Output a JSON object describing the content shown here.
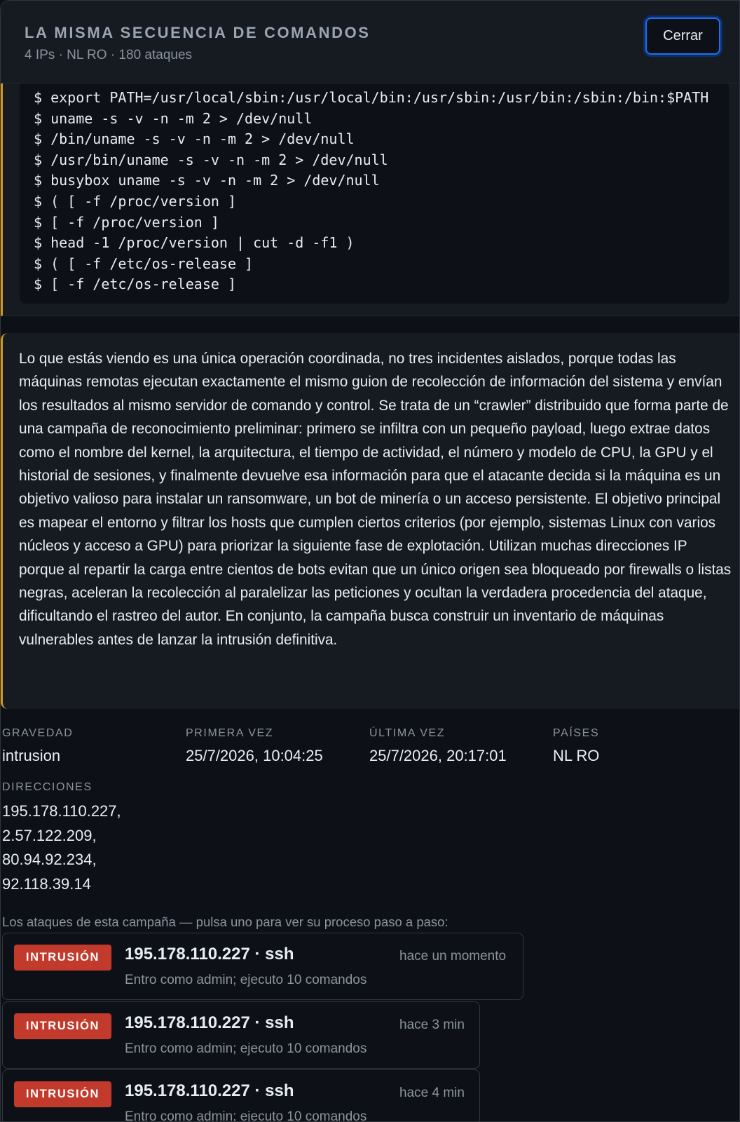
{
  "header": {
    "title": "LA MISMA SECUENCIA DE COMANDOS",
    "subtitle": "4 IPs · NL RO · 180 ataques",
    "close_label": "Cerrar"
  },
  "commands": [
    "$ export PATH=/usr/local/sbin:/usr/local/bin:/usr/sbin:/usr/bin:/sbin:/bin:$PATH",
    "$ uname -s -v -n -m 2 > /dev/null",
    "$ /bin/uname -s -v -n -m 2 > /dev/null",
    "$ /usr/bin/uname -s -v -n -m 2 > /dev/null",
    "$ busybox uname -s -v -n -m 2 > /dev/null",
    "$ ( [ -f /proc/version ]",
    "$ [ -f /proc/version ]",
    "$ head -1 /proc/version | cut -d -f1 )",
    "$ ( [ -f /etc/os-release ]",
    "$ [ -f /etc/os-release ]"
  ],
  "description": "Lo que estás viendo es una única operación coordinada, no tres incidentes aislados, porque todas las máquinas remotas ejecutan exactamente el mismo guion de recolección de información del sistema y envían los resultados al mismo servidor de comando y control. Se trata de un “crawler” distribuido que forma parte de una campaña de reconocimiento preliminar: primero se infiltra con un pequeño payload, luego extrae datos como el nombre del kernel, la arquitectura, el tiempo de actividad, el número y modelo de CPU, la GPU y el historial de sesiones, y finalmente devuelve esa información para que el atacante decida si la máquina es un objetivo valioso para instalar un ransomware, un bot de minería o un acceso persistente. El objetivo principal es mapear el entorno y filtrar los hosts que cumplen ciertos criterios (por ejemplo, sistemas Linux con varios núcleos y acceso a GPU) para priorizar la siguiente fase de explotación. Utilizan muchas direcciones IP porque al repartir la carga entre cientos de bots evitan que un único origen sea bloqueado por firewalls o listas negras, aceleran la recolección al paralelizar las peticiones y ocultan la verdadera procedencia del ataque, dificultando el rastreo del autor. En conjunto, la campaña busca construir un inventario de máquinas vulnerables antes de lanzar la intrusión definitiva.",
  "meta": {
    "severity_label": "GRAVEDAD",
    "severity_value": "intrusion",
    "first_label": "PRIMERA VEZ",
    "first_value": "25/7/2026, 10:04:25",
    "last_label": "ÚLTIMA VEZ",
    "last_value": "25/7/2026, 20:17:01",
    "countries_label": "PAÍSES",
    "countries_value": "NL RO",
    "addresses_label": "DIRECCIONES",
    "addresses": [
      "195.178.110.227,",
      "2.57.122.209,",
      "80.94.92.234,",
      "92.118.39.14"
    ]
  },
  "attacks_intro": "Los ataques de esta campaña — pulsa uno para ver su proceso paso a paso:",
  "attacks": [
    {
      "badge": "INTRUSIÓN",
      "title": "195.178.110.227 · ssh",
      "subtitle": "Entro como admin; ejecuto 10 comandos",
      "time": "hace un momento"
    },
    {
      "badge": "INTRUSIÓN",
      "title": "195.178.110.227 · ssh",
      "subtitle": "Entro como admin; ejecuto 10 comandos",
      "time": "hace 3 min"
    },
    {
      "badge": "INTRUSIÓN",
      "title": "195.178.110.227 · ssh",
      "subtitle": "Entro como admin; ejecuto 10 comandos",
      "time": "hace 4 min"
    }
  ],
  "colors": {
    "background": "#0d1117",
    "surface": "#161b22",
    "accent_border": "#d29922",
    "badge_red": "#c23a2b",
    "focus_blue": "#1f6feb"
  }
}
